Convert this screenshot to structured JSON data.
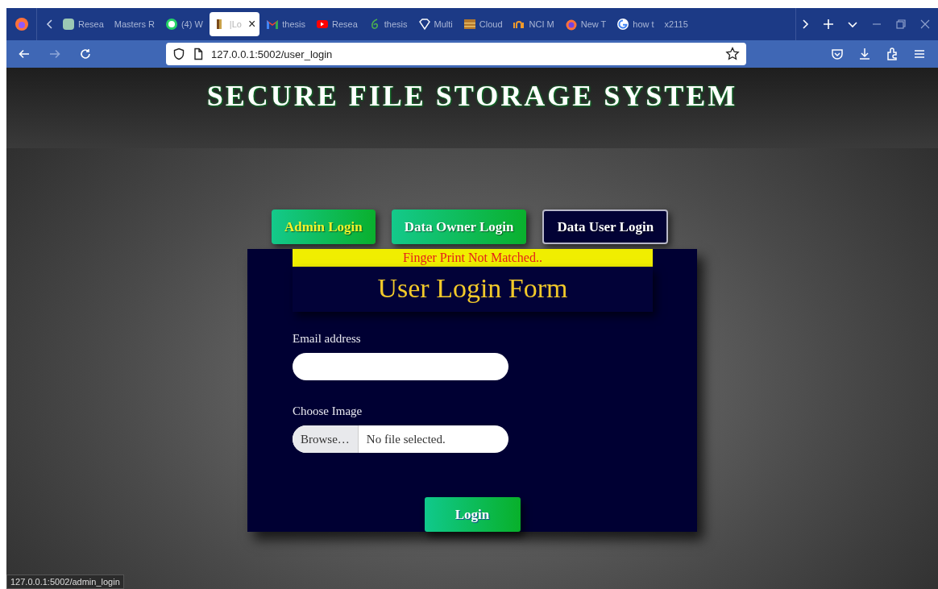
{
  "browser": {
    "tabs": [
      {
        "label": "Resea",
        "selected": false
      },
      {
        "label": "Masters R",
        "selected": false
      },
      {
        "label": "(4) W",
        "selected": false
      },
      {
        "label": "|Lo",
        "selected": true,
        "close": "×"
      },
      {
        "label": "thesis",
        "selected": false
      },
      {
        "label": "Resea",
        "selected": false
      },
      {
        "label": "thesis",
        "selected": false
      },
      {
        "label": "Multi",
        "selected": false
      },
      {
        "label": "Cloud",
        "selected": false
      },
      {
        "label": "NCI M",
        "selected": false
      },
      {
        "label": "New T",
        "selected": false
      },
      {
        "label": "how t",
        "selected": false
      },
      {
        "label": "x2115",
        "selected": false
      }
    ],
    "address": "127.0.0.1:5002/user_login"
  },
  "page": {
    "title": "SECURE FILE STORAGE SYSTEM",
    "login_tabs": [
      {
        "kind": "accented",
        "label": "Admin Login",
        "selected": false
      },
      {
        "kind": "plain",
        "label": "Data Owner Login",
        "selected": false
      },
      {
        "kind": "plain",
        "label": "Data User Login",
        "selected": true
      }
    ],
    "alert": "Finger Print Not Matched..",
    "form_title": "User Login Form",
    "fields": [
      {
        "kind": "text",
        "label": "Email address"
      },
      {
        "kind": "file",
        "label": "Choose Image",
        "button": "Browse…",
        "value": "No file selected."
      }
    ],
    "submit": "Login"
  },
  "status_bar": "127.0.0.1:5002/admin_login"
}
